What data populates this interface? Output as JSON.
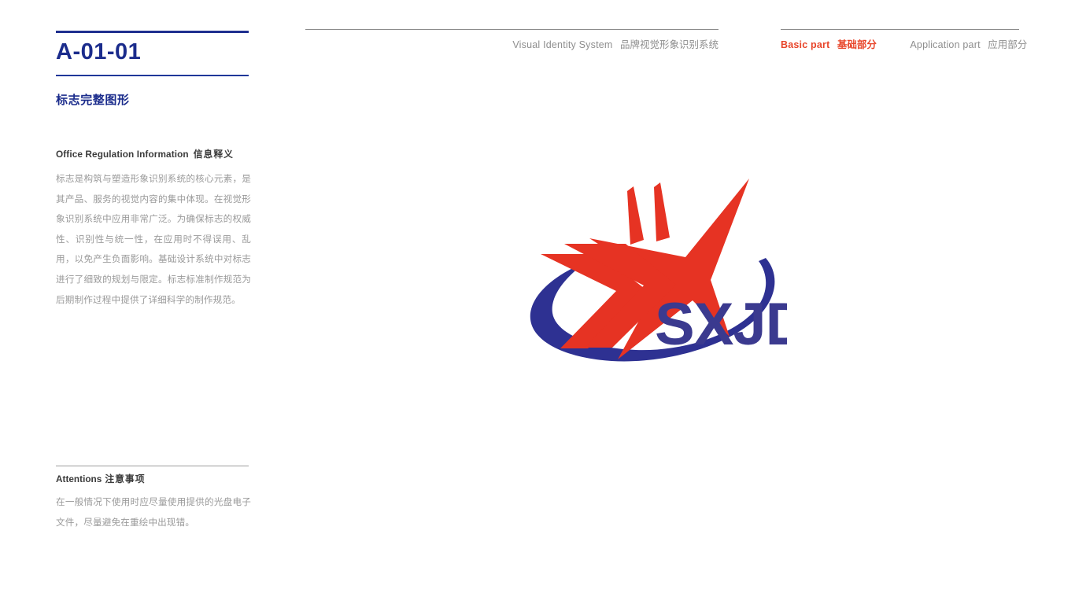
{
  "topnav": {
    "center_items": [
      {
        "en": "Visual Identity System",
        "cn": "品牌视觉形象识别系统",
        "active": false
      }
    ],
    "right_items": [
      {
        "en": "Basic part",
        "cn": "基础部分",
        "active": true
      },
      {
        "en": "Application part",
        "cn": "应用部分",
        "active": false
      }
    ]
  },
  "sidebar": {
    "page_code": "A-01-01",
    "section_title": "标志完整图形",
    "info": {
      "heading_en": "Office Regulation Information",
      "heading_cn": "信息释义",
      "body": "标志是构筑与塑造形象识别系统的核心元素，是其产品、服务的视觉内容的集中体现。在视觉形象识别系统中应用非常广泛。为确保标志的权威性、识别性与统一性，在应用时不得误用、乱用，以免产生负面影响。基础设计系统中对标志进行了细致的规划与限定。标志标准制作规范为后期制作过程中提供了详细科学的制作规范。"
    },
    "attentions": {
      "heading_en": "Attentions",
      "heading_cn": "注意事项",
      "body": "在一般情况下使用时应尽量使用提供的光盘电子文件，尽量避免在重绘中出现错。"
    }
  },
  "logo": {
    "wordmark": "SXJD",
    "star_color": "#E63323",
    "swoosh_color": "#2E3192",
    "description": "red-star-with-motion-trails-and-blue-orbit-swoosh"
  },
  "colors": {
    "heading_blue": "#1B2C8C",
    "accent_red": "#E8452A",
    "muted_gray": "#9a9a9a",
    "rule_gray": "#8c8c8c"
  }
}
